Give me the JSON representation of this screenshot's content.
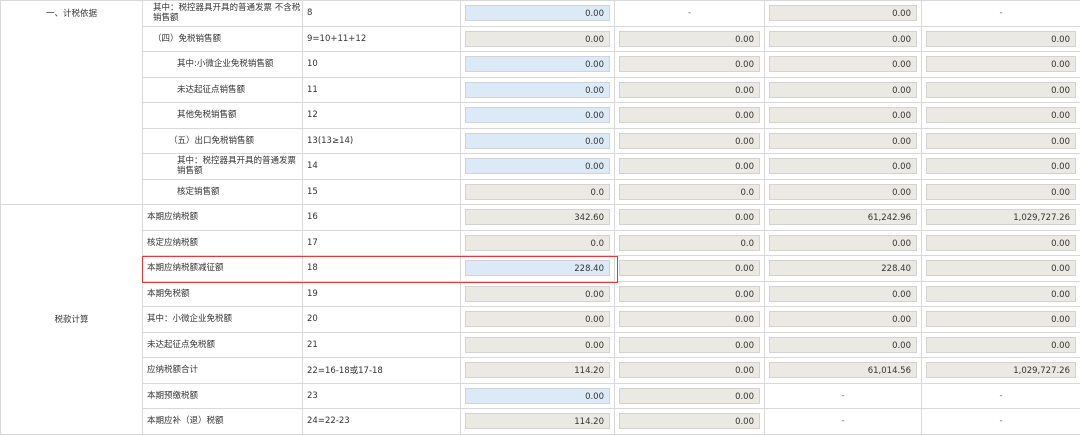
{
  "sections": {
    "basis": "一、计税依据",
    "calc": "税款计算"
  },
  "rows": [
    {
      "name": "其中：税控器具开具的普通发票 不含税销售额",
      "line": "8",
      "values": [
        {
          "v": "0.00",
          "t": "edit"
        },
        {
          "v": "-",
          "t": "dash"
        },
        {
          "v": "0.00",
          "t": "ro"
        },
        {
          "v": "-",
          "t": "dash"
        }
      ]
    },
    {
      "name": "（四）免税销售额",
      "line": "9=10+11+12",
      "values": [
        {
          "v": "0.00",
          "t": "ro"
        },
        {
          "v": "0.00",
          "t": "ro"
        },
        {
          "v": "0.00",
          "t": "ro"
        },
        {
          "v": "0.00",
          "t": "ro"
        }
      ]
    },
    {
      "name": "其中:小微企业免税销售额",
      "line": "10",
      "values": [
        {
          "v": "0.00",
          "t": "edit"
        },
        {
          "v": "0.00",
          "t": "ro"
        },
        {
          "v": "0.00",
          "t": "ro"
        },
        {
          "v": "0.00",
          "t": "ro"
        }
      ]
    },
    {
      "name": "未达起征点销售额",
      "line": "11",
      "values": [
        {
          "v": "0.00",
          "t": "edit"
        },
        {
          "v": "0.00",
          "t": "ro"
        },
        {
          "v": "0.00",
          "t": "ro"
        },
        {
          "v": "0.00",
          "t": "ro"
        }
      ]
    },
    {
      "name": "其他免税销售额",
      "line": "12",
      "values": [
        {
          "v": "0.00",
          "t": "edit"
        },
        {
          "v": "0.00",
          "t": "ro"
        },
        {
          "v": "0.00",
          "t": "ro"
        },
        {
          "v": "0.00",
          "t": "ro"
        }
      ]
    },
    {
      "name": "（五）出口免税销售额",
      "line": "13(13≥14)",
      "values": [
        {
          "v": "0.00",
          "t": "edit"
        },
        {
          "v": "0.00",
          "t": "ro"
        },
        {
          "v": "0.00",
          "t": "ro"
        },
        {
          "v": "0.00",
          "t": "ro"
        }
      ]
    },
    {
      "name": "其中：税控器具开具的普通发票销售额",
      "line": "14",
      "values": [
        {
          "v": "0.00",
          "t": "edit"
        },
        {
          "v": "0.00",
          "t": "ro"
        },
        {
          "v": "0.00",
          "t": "ro"
        },
        {
          "v": "0.00",
          "t": "ro"
        }
      ]
    },
    {
      "name": "核定销售额",
      "line": "15",
      "values": [
        {
          "v": "0.0",
          "t": "ro"
        },
        {
          "v": "0.0",
          "t": "ro"
        },
        {
          "v": "0.00",
          "t": "ro"
        },
        {
          "v": "0.00",
          "t": "ro"
        }
      ]
    },
    {
      "name": "本期应纳税额",
      "line": "16",
      "values": [
        {
          "v": "342.60",
          "t": "ro"
        },
        {
          "v": "0.00",
          "t": "ro"
        },
        {
          "v": "61,242.96",
          "t": "ro"
        },
        {
          "v": "1,029,727.26",
          "t": "ro"
        }
      ]
    },
    {
      "name": "核定应纳税额",
      "line": "17",
      "values": [
        {
          "v": "0.0",
          "t": "ro"
        },
        {
          "v": "0.0",
          "t": "ro"
        },
        {
          "v": "0.00",
          "t": "ro"
        },
        {
          "v": "0.00",
          "t": "ro"
        }
      ]
    },
    {
      "name": "本期应纳税额减征额",
      "line": "18",
      "values": [
        {
          "v": "228.40",
          "t": "edit"
        },
        {
          "v": "0.00",
          "t": "ro"
        },
        {
          "v": "228.40",
          "t": "ro"
        },
        {
          "v": "0.00",
          "t": "ro"
        }
      ]
    },
    {
      "name": "本期免税额",
      "line": "19",
      "values": [
        {
          "v": "0.00",
          "t": "ro"
        },
        {
          "v": "0.00",
          "t": "ro"
        },
        {
          "v": "0.00",
          "t": "ro"
        },
        {
          "v": "0.00",
          "t": "ro"
        }
      ]
    },
    {
      "name": "其中：小微企业免税额",
      "line": "20",
      "values": [
        {
          "v": "0.00",
          "t": "ro"
        },
        {
          "v": "0.00",
          "t": "ro"
        },
        {
          "v": "0.00",
          "t": "ro"
        },
        {
          "v": "0.00",
          "t": "ro"
        }
      ]
    },
    {
      "name": "未达起征点免税额",
      "line": "21",
      "values": [
        {
          "v": "0.00",
          "t": "ro"
        },
        {
          "v": "0.00",
          "t": "ro"
        },
        {
          "v": "0.00",
          "t": "ro"
        },
        {
          "v": "0.00",
          "t": "ro"
        }
      ]
    },
    {
      "name": "应纳税额合计",
      "line": "22=16-18或17-18",
      "values": [
        {
          "v": "114.20",
          "t": "ro"
        },
        {
          "v": "0.00",
          "t": "ro"
        },
        {
          "v": "61,014.56",
          "t": "ro"
        },
        {
          "v": "1,029,727.26",
          "t": "ro"
        }
      ]
    },
    {
      "name": "本期预缴税额",
      "line": "23",
      "values": [
        {
          "v": "0.00",
          "t": "edit"
        },
        {
          "v": "0.00",
          "t": "ro"
        },
        {
          "v": "-",
          "t": "dash"
        },
        {
          "v": "-",
          "t": "dash"
        }
      ]
    },
    {
      "name": "本期应补（退）税额",
      "line": "24=22-23",
      "values": [
        {
          "v": "114.20",
          "t": "ro"
        },
        {
          "v": "0.00",
          "t": "ro"
        },
        {
          "v": "-",
          "t": "dash"
        },
        {
          "v": "-",
          "t": "dash"
        }
      ]
    }
  ]
}
